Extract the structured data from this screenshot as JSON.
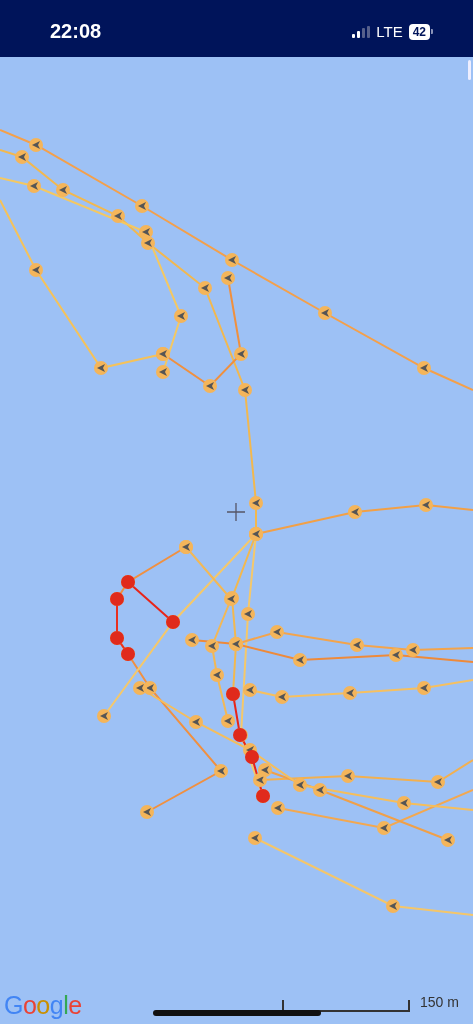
{
  "status_bar": {
    "time": "22:08",
    "network": "LTE",
    "battery": "42"
  },
  "map": {
    "attribution": "Google",
    "scale_label": "150 m"
  }
}
